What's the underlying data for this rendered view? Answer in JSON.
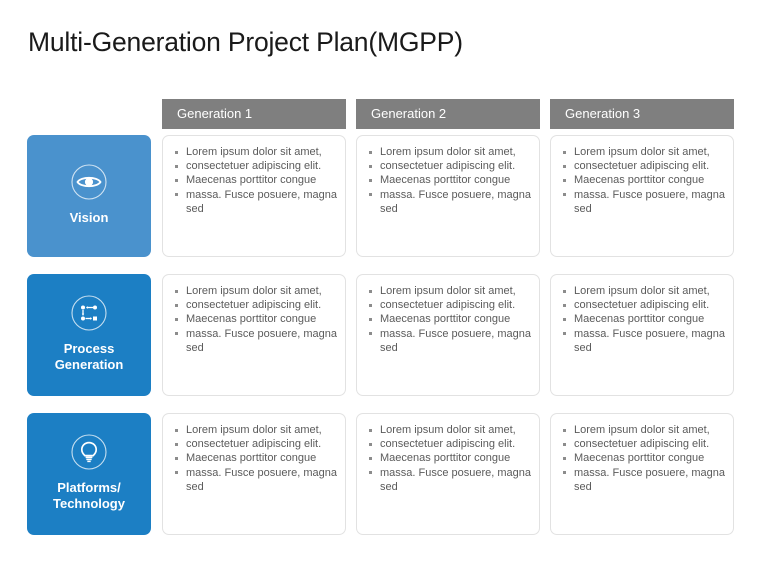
{
  "slide": {
    "title": "Multi-Generation Project Plan(MGPP)",
    "background": "#ffffff"
  },
  "colors": {
    "header_bar": "#7f7f7f",
    "header_text": "#ffffff",
    "tile_vision": "#4a92cd",
    "tile_process": "#1c7fc4",
    "tile_platforms": "#1c7fc4",
    "card_border": "#e2e2e2",
    "body_text": "#5b5b5b",
    "title_text": "#1a1a1a",
    "bullet": "#8c8c8c"
  },
  "columns": [
    {
      "label": "Generation 1"
    },
    {
      "label": "Generation 2"
    },
    {
      "label": "Generation 3"
    }
  ],
  "rows": [
    {
      "category": "Vision",
      "icon": "eye-icon",
      "color": "#4a92cd",
      "cells": [
        {
          "bullets": [
            "Lorem ipsum dolor sit amet,",
            "consectetuer adipiscing elit.",
            "Maecenas porttitor congue",
            "massa. Fusce posuere, magna sed"
          ]
        },
        {
          "bullets": [
            "Lorem ipsum dolor sit amet,",
            "consectetuer adipiscing elit.",
            "Maecenas porttitor congue",
            "massa. Fusce posuere, magna sed"
          ]
        },
        {
          "bullets": [
            "Lorem ipsum dolor sit amet,",
            "consectetuer adipiscing elit.",
            "Maecenas porttitor congue",
            "massa. Fusce posuere, magna sed"
          ]
        }
      ]
    },
    {
      "category": "Process\nGeneration",
      "icon": "process-flow-icon",
      "color": "#1c7fc4",
      "cells": [
        {
          "bullets": [
            "Lorem ipsum dolor sit amet,",
            "consectetuer adipiscing elit.",
            "Maecenas porttitor congue",
            "massa. Fusce posuere, magna sed"
          ]
        },
        {
          "bullets": [
            "Lorem ipsum dolor sit amet,",
            "consectetuer adipiscing elit.",
            "Maecenas porttitor congue",
            "massa. Fusce posuere, magna sed"
          ]
        },
        {
          "bullets": [
            "Lorem ipsum dolor sit amet,",
            "consectetuer adipiscing elit.",
            "Maecenas porttitor congue",
            "massa. Fusce posuere, magna sed"
          ]
        }
      ]
    },
    {
      "category": "Platforms/\nTechnology",
      "icon": "lightbulb-icon",
      "color": "#1c7fc4",
      "cells": [
        {
          "bullets": [
            "Lorem ipsum dolor sit amet,",
            "consectetuer adipiscing elit.",
            "Maecenas porttitor congue",
            "massa. Fusce posuere, magna sed"
          ]
        },
        {
          "bullets": [
            "Lorem ipsum dolor sit amet,",
            "consectetuer adipiscing elit.",
            "Maecenas porttitor congue",
            "massa. Fusce posuere, magna sed"
          ]
        },
        {
          "bullets": [
            "Lorem ipsum dolor sit amet,",
            "consectetuer adipiscing elit.",
            "Maecenas porttitor congue",
            "massa. Fusce posuere, magna sed"
          ]
        }
      ]
    }
  ]
}
